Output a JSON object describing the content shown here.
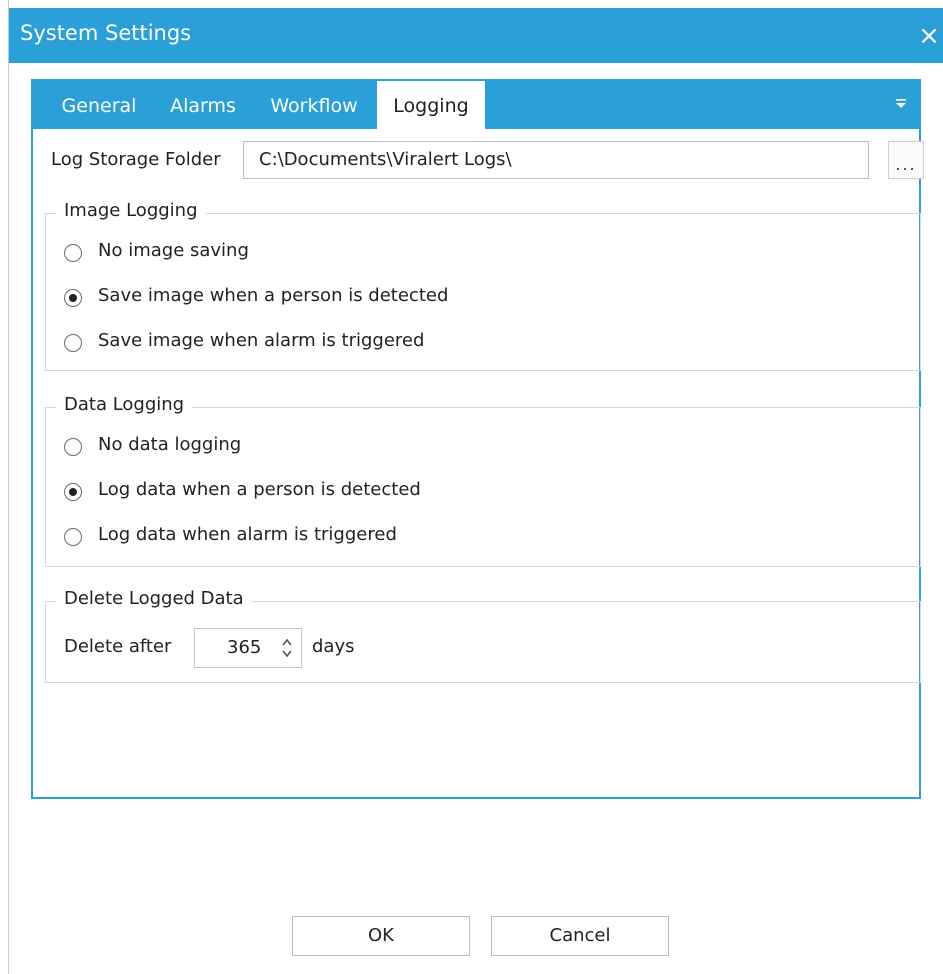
{
  "window": {
    "title": "System Settings",
    "close_glyph": "×"
  },
  "tabs": [
    {
      "label": "General",
      "active": false
    },
    {
      "label": "Alarms",
      "active": false
    },
    {
      "label": "Workflow",
      "active": false
    },
    {
      "label": "Logging",
      "active": true
    }
  ],
  "tab_overflow_icon": "chevron-down-icon",
  "log_storage": {
    "label": "Log Storage Folder",
    "value": "C:\\Documents\\Viralert Logs\\",
    "browse_label": "..."
  },
  "image_logging": {
    "title": "Image Logging",
    "options": [
      {
        "label": "No image saving",
        "checked": false
      },
      {
        "label": "Save image when a person is detected",
        "checked": true
      },
      {
        "label": "Save image when alarm is triggered",
        "checked": false
      }
    ]
  },
  "data_logging": {
    "title": "Data Logging",
    "options": [
      {
        "label": "No data logging",
        "checked": false
      },
      {
        "label": "Log data when a person is detected",
        "checked": true
      },
      {
        "label": "Log data when alarm is triggered",
        "checked": false
      }
    ]
  },
  "delete_logged": {
    "title": "Delete Logged Data",
    "prefix": "Delete after",
    "value": "365",
    "suffix": "days"
  },
  "footer": {
    "ok_label": "OK",
    "cancel_label": "Cancel"
  },
  "colors": {
    "accent": "#2a9fd8",
    "border": "#d8d8d8"
  }
}
